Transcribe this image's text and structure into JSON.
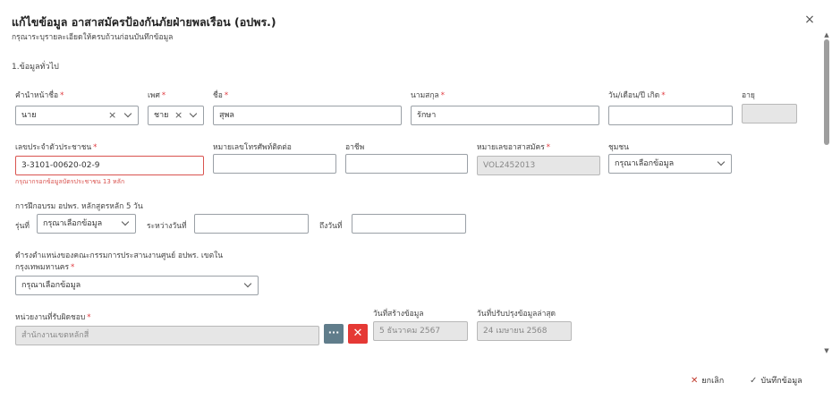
{
  "header": {
    "title": "แก้ไขข้อมูล อาสาสมัครป้องกันภัยฝ่ายพลเรือน (อปพร.)",
    "subtitle": "กรุณาระบุรายละเอียดให้ครบถ้วนก่อนบันทึกข้อมูล",
    "close": "×"
  },
  "section1": {
    "title": "1.ข้อมูลทั่วไป"
  },
  "required_mark": "*",
  "fields": {
    "prefix": {
      "label": "คำนำหน้าชื่อ",
      "value": "นาย"
    },
    "gender": {
      "label": "เพศ",
      "value": "ชาย"
    },
    "first_name": {
      "label": "ชื่อ",
      "value": "สุพล"
    },
    "last_name": {
      "label": "นามสกุล",
      "value": "รักษา"
    },
    "dob": {
      "label": "วัน/เดือน/ปี เกิด",
      "value": ""
    },
    "age": {
      "label": "อายุ",
      "value": ""
    },
    "citizen_id": {
      "label": "เลขประจำตัวประชาชน",
      "value": "3-3101-00620-02-9",
      "error": "กรุณากรอกข้อมูลบัตรประชาชน 13 หลัก"
    },
    "phone": {
      "label": "หมายเลขโทรศัพท์ติดต่อ",
      "value": ""
    },
    "occupation": {
      "label": "อาชีพ",
      "value": ""
    },
    "volunteer_no": {
      "label": "หมายเลขอาสาสมัคร",
      "value": "VOL2452013"
    },
    "community": {
      "label": "ชุมชน",
      "placeholder": "กรุณาเลือกข้อมูล"
    },
    "training_title": "การฝึกอบรม อปพร. หลักสูตรหลัก 5 วัน",
    "batch": {
      "label": "รุ่นที่",
      "placeholder": "กรุณาเลือกข้อมูล"
    },
    "from_date": {
      "label": "ระหว่างวันที่",
      "value": ""
    },
    "to_date": {
      "label": "ถึงวันที่",
      "value": ""
    },
    "position": {
      "label_line1": "ดำรงตำแหน่งของคณะกรรมการประสานงานศูนย์ อปพร. เขตใน",
      "label_line2": "กรุงเทพมหานคร",
      "placeholder": "กรุณาเลือกข้อมูล"
    },
    "agency": {
      "label": "หน่วยงานที่รับผิดชอบ",
      "value": "สำนักงานเขตหลักสี่"
    },
    "created": {
      "label": "วันที่สร้างข้อมูล",
      "value": "5 ธันวาคม 2567"
    },
    "updated": {
      "label": "วันที่ปรับปรุงข้อมูลล่าสุด",
      "value": "24 เมษายน 2568"
    }
  },
  "buttons": {
    "dots": "···",
    "delete": "✕",
    "cancel": "ยกเลิก",
    "save": "บันทึกข้อมูล"
  },
  "icons": {
    "clear": "×",
    "cancel": "✕",
    "save": "✓"
  }
}
